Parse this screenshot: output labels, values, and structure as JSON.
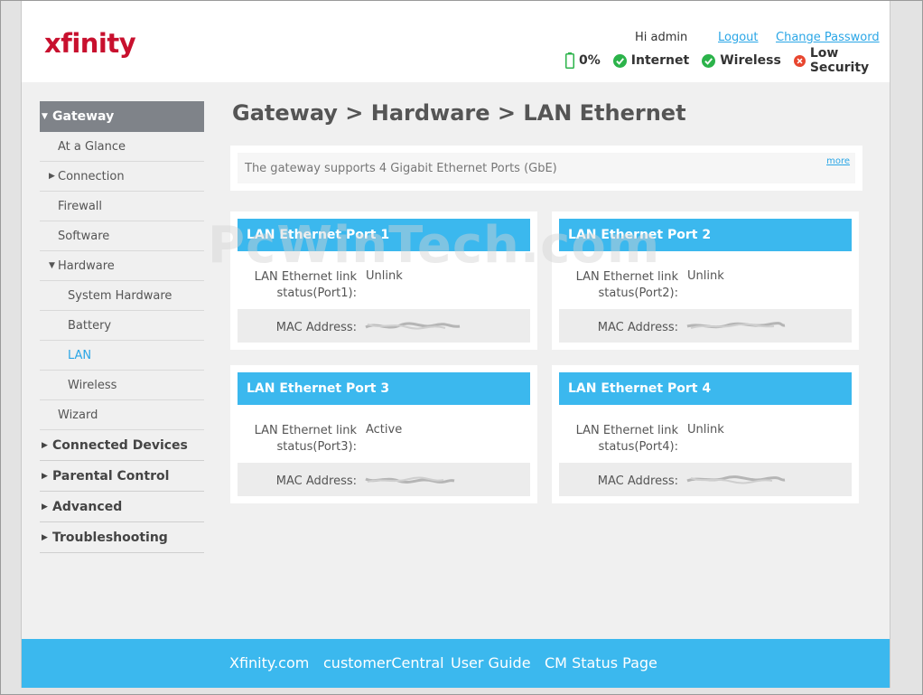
{
  "header": {
    "logo": "xfinity",
    "greeting": "Hi admin",
    "logout": "Logout",
    "change_password": "Change Password",
    "status": {
      "battery": "0%",
      "internet": "Internet",
      "wireless": "Wireless",
      "security": "Low Security"
    }
  },
  "sidebar": {
    "gateway": "Gateway",
    "at_a_glance": "At a Glance",
    "connection": "Connection",
    "firewall": "Firewall",
    "software": "Software",
    "hardware": "Hardware",
    "system_hardware": "System Hardware",
    "battery": "Battery",
    "lan": "LAN",
    "wireless": "Wireless",
    "wizard": "Wizard",
    "connected_devices": "Connected Devices",
    "parental_control": "Parental Control",
    "advanced": "Advanced",
    "troubleshooting": "Troubleshooting"
  },
  "main": {
    "title": "Gateway > Hardware > LAN Ethernet",
    "info": "The gateway supports 4 Gigabit Ethernet Ports (GbE)",
    "more": "more",
    "ports": [
      {
        "name": "LAN Ethernet Port 1",
        "link_label_1": "LAN Ethernet link",
        "link_label_2": "status(Port1):",
        "status": "Unlink",
        "mac_label": "MAC Address:"
      },
      {
        "name": "LAN Ethernet Port 2",
        "link_label_1": "LAN Ethernet link",
        "link_label_2": "status(Port2):",
        "status": "Unlink",
        "mac_label": "MAC Address:"
      },
      {
        "name": "LAN Ethernet Port 3",
        "link_label_1": "LAN Ethernet link",
        "link_label_2": "status(Port3):",
        "status": "Active",
        "mac_label": "MAC Address:"
      },
      {
        "name": "LAN Ethernet Port 4",
        "link_label_1": "LAN Ethernet link",
        "link_label_2": "status(Port4):",
        "status": "Unlink",
        "mac_label": "MAC Address:"
      }
    ]
  },
  "footer": {
    "xfinity": "Xfinity.com",
    "customer_central": "customerCentral",
    "user_guide": "User Guide",
    "cm_status": "CM Status Page"
  },
  "watermark": "PcWinTech.com",
  "colors": {
    "accent": "#3bb8ee",
    "logo": "#c8102e",
    "ok": "#2bb34a",
    "error": "#e8462f",
    "link": "#2aa6e6"
  }
}
